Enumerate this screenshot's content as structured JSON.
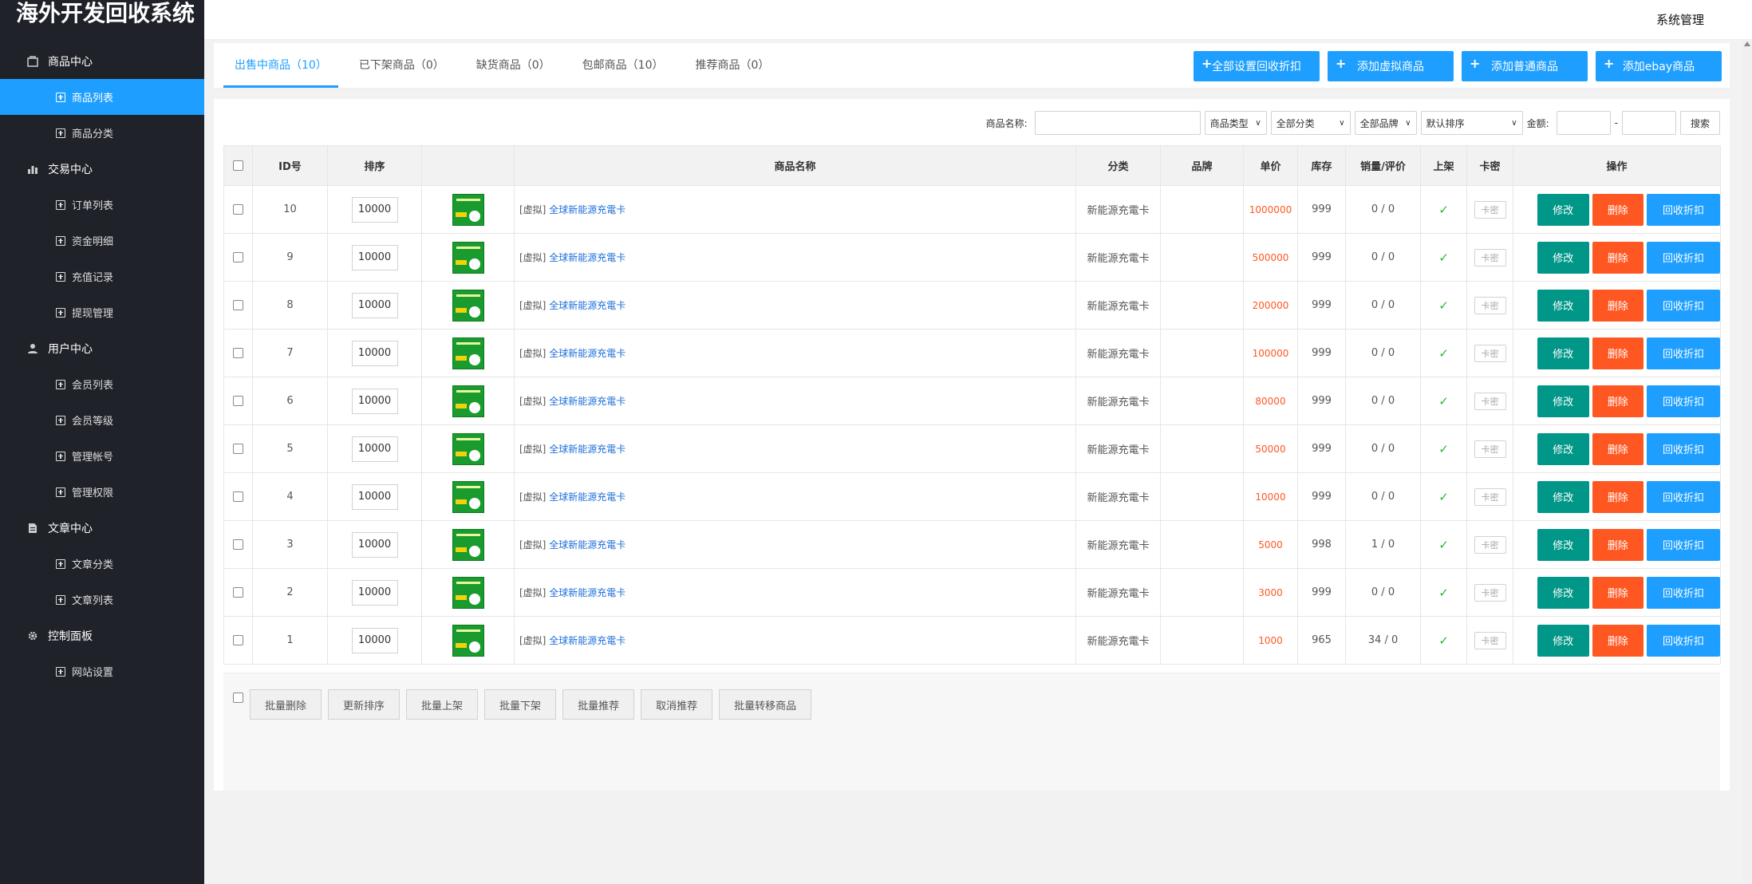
{
  "app": {
    "title": "海外开发回收系统",
    "top_right": "系统管理"
  },
  "sidebar": {
    "groups": [
      {
        "label": "商品中心",
        "icon": "shop-icon",
        "items": [
          {
            "label": "商品列表",
            "active": true
          },
          {
            "label": "商品分类"
          }
        ]
      },
      {
        "label": "交易中心",
        "icon": "chart-bar-icon",
        "items": [
          {
            "label": "订单列表"
          },
          {
            "label": "资金明细"
          },
          {
            "label": "充值记录"
          },
          {
            "label": "提现管理"
          }
        ]
      },
      {
        "label": "用户中心",
        "icon": "user-icon",
        "items": [
          {
            "label": "会员列表"
          },
          {
            "label": "会员等级"
          },
          {
            "label": "管理帐号"
          },
          {
            "label": "管理权限"
          }
        ]
      },
      {
        "label": "文章中心",
        "icon": "document-icon",
        "items": [
          {
            "label": "文章分类"
          },
          {
            "label": "文章列表"
          }
        ]
      },
      {
        "label": "控制面板",
        "icon": "gear-icon",
        "items": [
          {
            "label": "网站设置"
          }
        ]
      }
    ]
  },
  "tabs": [
    {
      "label": "出售中商品（10）",
      "active": true
    },
    {
      "label": "已下架商品（0）"
    },
    {
      "label": "缺货商品（0）"
    },
    {
      "label": "包邮商品（10）"
    },
    {
      "label": "推荐商品（0）"
    }
  ],
  "top_buttons": [
    "全部设置回收折扣",
    "添加虚拟商品",
    "添加普通商品",
    "添加ebay商品"
  ],
  "filter": {
    "name_label": "商品名称:",
    "name_value": "",
    "type_select": "商品类型",
    "category_select": "全部分类",
    "brand_select": "全部品牌",
    "sort_select": "默认排序",
    "amount_label": "金额:",
    "amount_sep": "-",
    "search_label": "搜索"
  },
  "table": {
    "headers": {
      "id": "ID号",
      "sort": "排序",
      "name": "商品名称",
      "category": "分类",
      "brand": "品牌",
      "price": "单价",
      "stock": "库存",
      "sales": "销量/评价",
      "listed": "上架",
      "card": "卡密",
      "ops": "操作"
    },
    "card_label": "卡密",
    "op_edit": "修改",
    "op_delete": "删除",
    "op_recycle": "回收折扣",
    "rows": [
      {
        "id": "10",
        "sort": "10000",
        "tag": "[虚拟]",
        "name": "全球新能源充電卡",
        "category": "新能源充電卡",
        "brand": "",
        "price": "1000000",
        "stock": "999",
        "sales": "0 / 0"
      },
      {
        "id": "9",
        "sort": "10000",
        "tag": "[虚拟]",
        "name": "全球新能源充電卡",
        "category": "新能源充電卡",
        "brand": "",
        "price": "500000",
        "stock": "999",
        "sales": "0 / 0"
      },
      {
        "id": "8",
        "sort": "10000",
        "tag": "[虚拟]",
        "name": "全球新能源充電卡",
        "category": "新能源充電卡",
        "brand": "",
        "price": "200000",
        "stock": "999",
        "sales": "0 / 0"
      },
      {
        "id": "7",
        "sort": "10000",
        "tag": "[虚拟]",
        "name": "全球新能源充電卡",
        "category": "新能源充電卡",
        "brand": "",
        "price": "100000",
        "stock": "999",
        "sales": "0 / 0"
      },
      {
        "id": "6",
        "sort": "10000",
        "tag": "[虚拟]",
        "name": "全球新能源充電卡",
        "category": "新能源充電卡",
        "brand": "",
        "price": "80000",
        "stock": "999",
        "sales": "0 / 0"
      },
      {
        "id": "5",
        "sort": "10000",
        "tag": "[虚拟]",
        "name": "全球新能源充電卡",
        "category": "新能源充電卡",
        "brand": "",
        "price": "50000",
        "stock": "999",
        "sales": "0 / 0"
      },
      {
        "id": "4",
        "sort": "10000",
        "tag": "[虚拟]",
        "name": "全球新能源充電卡",
        "category": "新能源充電卡",
        "brand": "",
        "price": "10000",
        "stock": "999",
        "sales": "0 / 0"
      },
      {
        "id": "3",
        "sort": "10000",
        "tag": "[虚拟]",
        "name": "全球新能源充電卡",
        "category": "新能源充電卡",
        "brand": "",
        "price": "5000",
        "stock": "998",
        "sales": "1 / 0"
      },
      {
        "id": "2",
        "sort": "10000",
        "tag": "[虚拟]",
        "name": "全球新能源充電卡",
        "category": "新能源充電卡",
        "brand": "",
        "price": "3000",
        "stock": "999",
        "sales": "0 / 0"
      },
      {
        "id": "1",
        "sort": "10000",
        "tag": "[虚拟]",
        "name": "全球新能源充電卡",
        "category": "新能源充電卡",
        "brand": "",
        "price": "1000",
        "stock": "965",
        "sales": "34 / 0"
      }
    ]
  },
  "bottom_buttons": [
    "批量删除",
    "更新排序",
    "批量上架",
    "批量下架",
    "批量推荐",
    "取消推荐",
    "批量转移商品"
  ],
  "colors": {
    "sidebar_bg": "#20222a",
    "accent": "#1e9fff",
    "edit": "#009688",
    "delete": "#ff5722"
  }
}
